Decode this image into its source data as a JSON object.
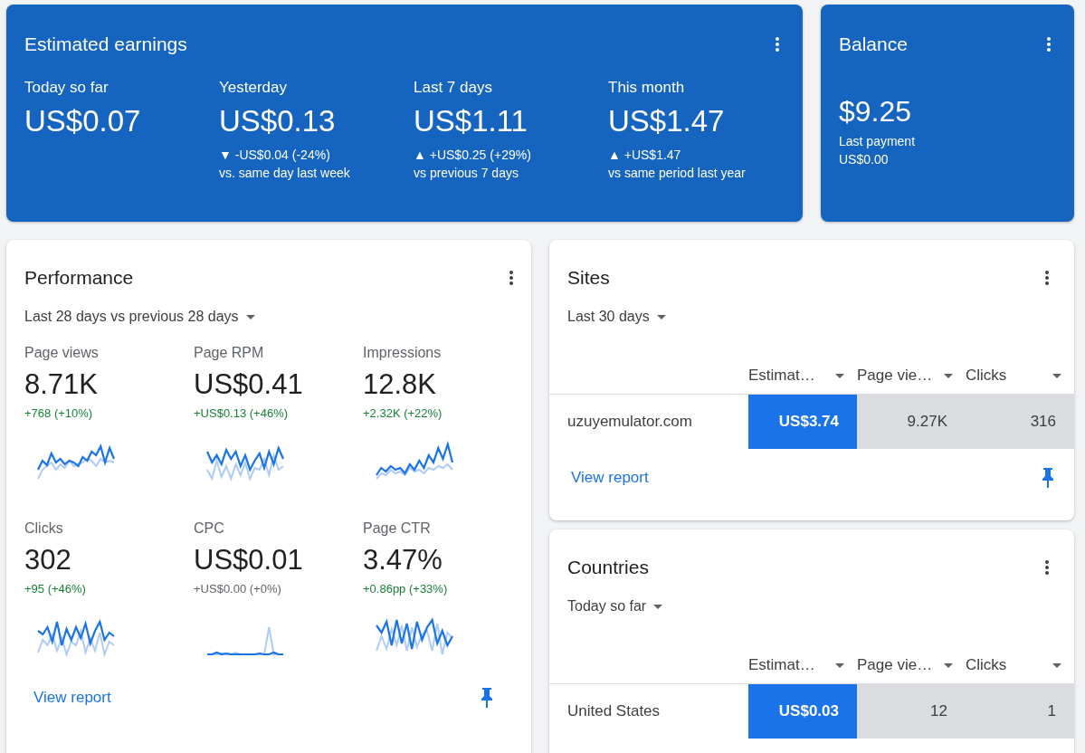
{
  "earnings": {
    "title": "Estimated earnings",
    "metrics": [
      {
        "label": "Today so far",
        "value": "US$0.07"
      },
      {
        "label": "Yesterday",
        "value": "US$0.13",
        "change": "▼ -US$0.04 (-24%)",
        "comparison": "vs. same day last week"
      },
      {
        "label": "Last 7 days",
        "value": "US$1.11",
        "change": "▲ +US$0.25 (+29%)",
        "comparison": "vs previous 7 days"
      },
      {
        "label": "This month",
        "value": "US$1.47",
        "change": "▲ +US$1.47",
        "comparison": "vs same period last year"
      }
    ]
  },
  "balance": {
    "title": "Balance",
    "value": "$9.25",
    "last_payment_label": "Last payment",
    "last_payment": "US$0.00"
  },
  "performance": {
    "title": "Performance",
    "range": "Last 28 days vs previous 28 days",
    "metrics": [
      {
        "label": "Page views",
        "value": "8.71K",
        "change": "+768 (+10%)",
        "kind": "increase"
      },
      {
        "label": "Page RPM",
        "value": "US$0.41",
        "change": "+US$0.13 (+46%)",
        "kind": "increase"
      },
      {
        "label": "Impressions",
        "value": "12.8K",
        "change": "+2.32K (+22%)",
        "kind": "increase"
      },
      {
        "label": "Clicks",
        "value": "302",
        "change": "+95 (+46%)",
        "kind": "increase"
      },
      {
        "label": "CPC",
        "value": "US$0.01",
        "change": "+US$0.00 (+0%)",
        "kind": "neutral"
      },
      {
        "label": "Page CTR",
        "value": "3.47%",
        "change": "+0.86pp (+33%)",
        "kind": "increase"
      }
    ],
    "view_report": "View report"
  },
  "sites": {
    "title": "Sites",
    "range": "Last 30 days",
    "columns": [
      {
        "label": "Estimat…",
        "selected": true
      },
      {
        "label": "Page vie…",
        "selected": false
      },
      {
        "label": "Clicks",
        "selected": false
      }
    ],
    "rows": [
      {
        "name": "uzuyemulator.com",
        "cells": [
          "US$3.74",
          "9.27K",
          "316"
        ]
      }
    ],
    "view_report": "View report"
  },
  "countries": {
    "title": "Countries",
    "range": "Today so far",
    "columns": [
      {
        "label": "Estimat…",
        "selected": true
      },
      {
        "label": "Page vie…",
        "selected": false
      },
      {
        "label": "Clicks",
        "selected": false
      }
    ],
    "rows": [
      {
        "name": "United States",
        "cells": [
          "US$0.03",
          "12",
          "1"
        ]
      }
    ]
  }
}
